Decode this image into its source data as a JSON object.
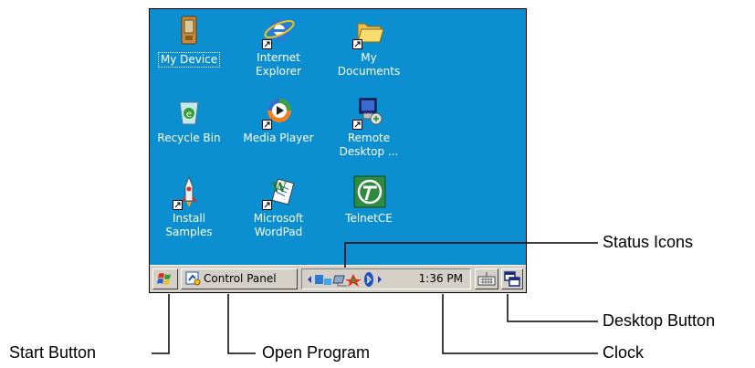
{
  "desktop": {
    "icons": [
      {
        "label_line1": "My Device",
        "label_line2": "",
        "icon": "pda-device-icon",
        "selected": true
      },
      {
        "label_line1": "Internet",
        "label_line2": "Explorer",
        "icon": "internet-explorer-icon"
      },
      {
        "label_line1": "My",
        "label_line2": "Documents",
        "icon": "folder-icon"
      },
      {
        "label_line1": "Recycle Bin",
        "label_line2": "",
        "icon": "recycle-bin-icon"
      },
      {
        "label_line1": "Media Player",
        "label_line2": "",
        "icon": "media-player-icon"
      },
      {
        "label_line1": "Remote",
        "label_line2": "Desktop ...",
        "icon": "remote-desktop-icon"
      },
      {
        "label_line1": "Install",
        "label_line2": "Samples",
        "icon": "installer-icon"
      },
      {
        "label_line1": "Microsoft",
        "label_line2": "WordPad",
        "icon": "wordpad-icon"
      },
      {
        "label_line1": "TelnetCE",
        "label_line2": "",
        "icon": "telnet-icon"
      }
    ],
    "background_color": "#0b8fd0"
  },
  "taskbar": {
    "start_icon": "windows-flag-icon",
    "open_program_label": "Control Panel",
    "open_program_icon": "control-panel-icon",
    "clock": "1:36 PM",
    "keyboard_icon": "keyboard-icon",
    "desktop_icon": "desktop-icon"
  },
  "callouts": {
    "status_icons": "Status Icons",
    "desktop_button": "Desktop Button",
    "start_button": "Start Button",
    "open_program": "Open Program",
    "clock": "Clock"
  }
}
